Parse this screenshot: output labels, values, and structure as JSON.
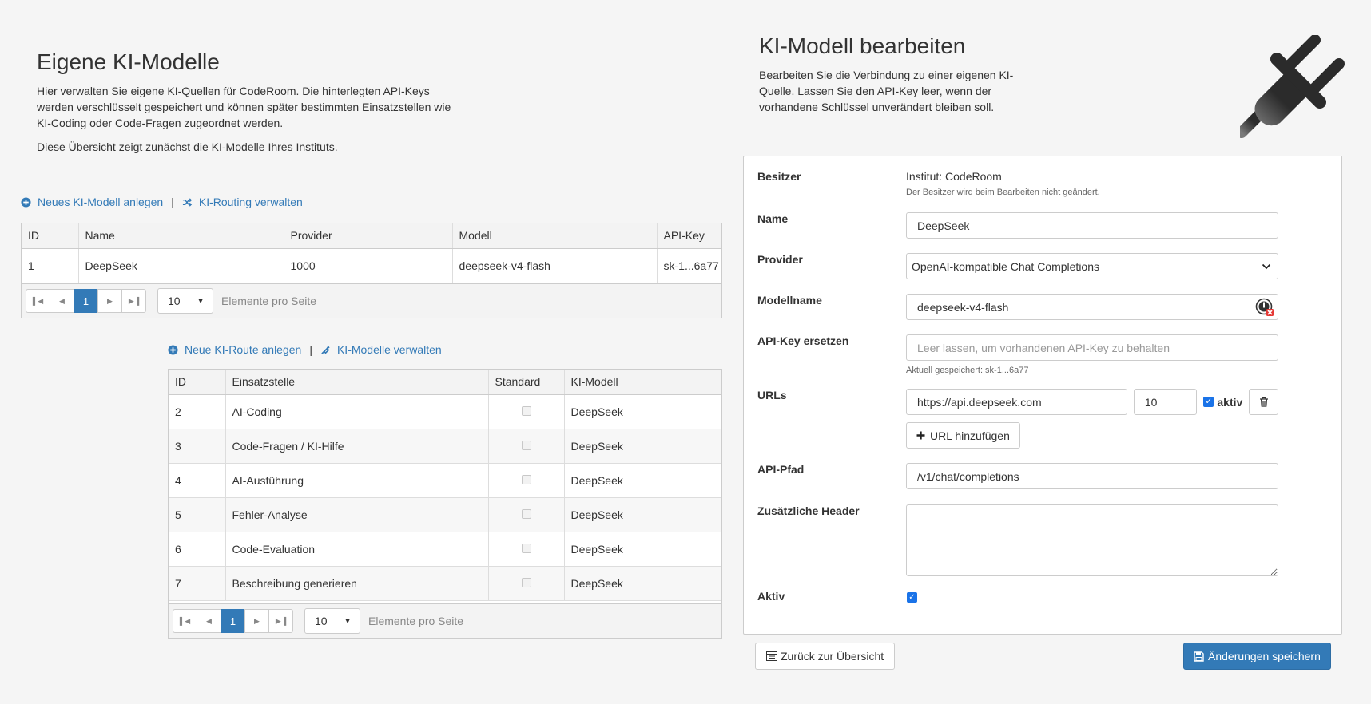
{
  "left": {
    "title": "Eigene KI-Modelle",
    "desc1": "Hier verwalten Sie eigene KI-Quellen für CodeRoom. Die hinterlegten API-Keys werden verschlüsselt gespeichert und können später bestimmten Einsatzstellen wie KI-Coding oder Code-Fragen zugeordnet werden.",
    "desc2": "Diese Übersicht zeigt zunächst die KI-Modelle Ihres Instituts.",
    "links": {
      "new_model": "Neues KI-Modell anlegen",
      "sep": "|",
      "routing": "KI-Routing verwalten"
    },
    "models_table": {
      "columns": [
        "ID",
        "Name",
        "Provider",
        "Modell",
        "API-Key"
      ],
      "rows": [
        {
          "id": "1",
          "name": "DeepSeek",
          "provider": "1000",
          "model": "deepseek-v4-flash",
          "apikey": "sk-1...6a77"
        }
      ]
    },
    "pager": {
      "page": "1",
      "page_size": "10",
      "label": "Elemente pro Seite"
    },
    "route_links": {
      "new_route": "Neue KI-Route anlegen",
      "sep": "|",
      "models": "KI-Modelle verwalten"
    },
    "routes_table": {
      "columns": [
        "ID",
        "Einsatzstelle",
        "Standard",
        "KI-Modell"
      ],
      "rows": [
        {
          "id": "2",
          "place": "AI-Coding",
          "model": "DeepSeek"
        },
        {
          "id": "3",
          "place": "Code-Fragen / KI-Hilfe",
          "model": "DeepSeek"
        },
        {
          "id": "4",
          "place": "AI-Ausführung",
          "model": "DeepSeek"
        },
        {
          "id": "5",
          "place": "Fehler-Analyse",
          "model": "DeepSeek"
        },
        {
          "id": "6",
          "place": "Code-Evaluation",
          "model": "DeepSeek"
        },
        {
          "id": "7",
          "place": "Beschreibung generieren",
          "model": "DeepSeek"
        }
      ]
    },
    "routes_pager": {
      "page": "1",
      "page_size": "10",
      "label": "Elemente pro Seite"
    }
  },
  "right": {
    "title": "KI-Modell bearbeiten",
    "desc": "Bearbeiten Sie die Verbindung zu einer eigenen KI-Quelle. Lassen Sie den API-Key leer, wenn der vorhandene Schlüssel unverändert bleiben soll.",
    "form": {
      "owner_label": "Besitzer",
      "owner_value": "Institut: CodeRoom",
      "owner_help": "Der Besitzer wird beim Bearbeiten nicht geändert.",
      "name_label": "Name",
      "name_value": "DeepSeek",
      "provider_label": "Provider",
      "provider_value": "OpenAI-kompatible Chat Completions",
      "modelname_label": "Modellname",
      "modelname_value": "deepseek-v4-flash",
      "apikey_label": "API-Key ersetzen",
      "apikey_placeholder": "Leer lassen, um vorhandenen API-Key zu behalten",
      "apikey_help": "Aktuell gespeichert: sk-1...6a77",
      "urls_label": "URLs",
      "url_value": "https://api.deepseek.com",
      "url_weight": "10",
      "url_active_label": "aktiv",
      "add_url_label": "URL hinzufügen",
      "apipath_label": "API-Pfad",
      "apipath_value": "/v1/chat/completions",
      "headers_label": "Zusätzliche Header",
      "headers_value": "",
      "active_label": "Aktiv"
    },
    "back_label": "Zurück zur Übersicht",
    "save_label": "Änderungen speichern"
  },
  "colors": {
    "accent": "#337ab7",
    "checkbox": "#1a73e8",
    "plug_dark": "#2b2b2b"
  }
}
